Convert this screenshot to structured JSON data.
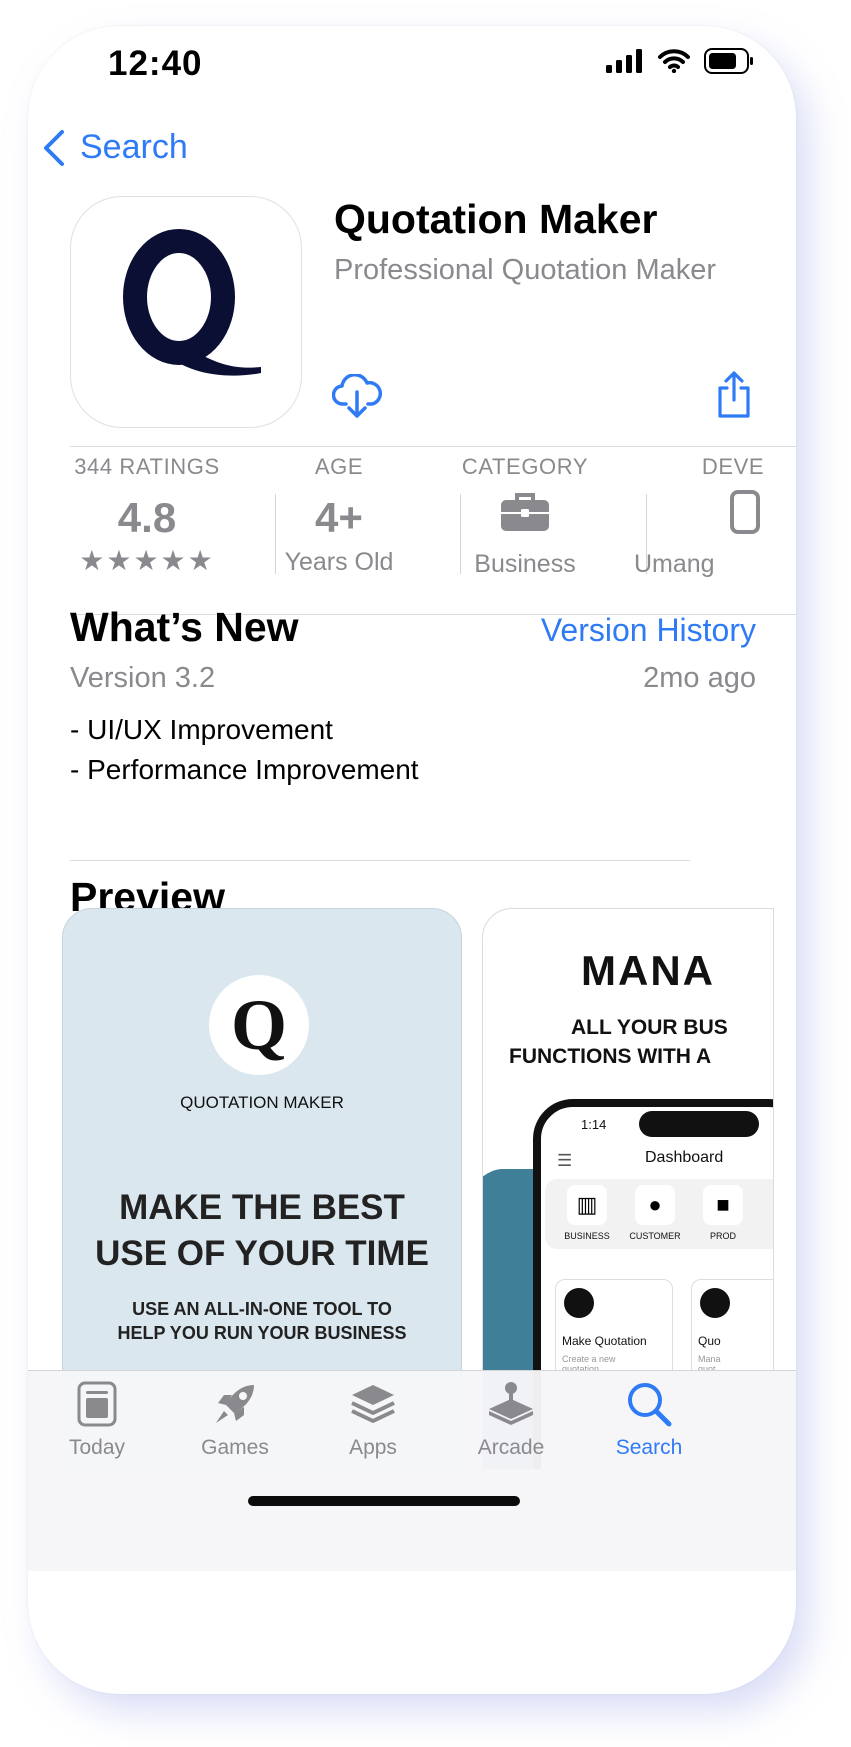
{
  "status_bar": {
    "time": "12:40"
  },
  "nav": {
    "back_label": "Search"
  },
  "app": {
    "name": "Quotation Maker",
    "subtitle": "Professional Quotation Maker",
    "icon_letter": "Q"
  },
  "info": {
    "ratings_label": "344 RATINGS",
    "rating_value": "4.8",
    "stars": "★★★★★",
    "age_label": "AGE",
    "age_value": "4+",
    "age_sub": "Years Old",
    "category_label": "CATEGORY",
    "category_value": "Business",
    "developer_label": "DEVE",
    "developer_value": "Umang"
  },
  "whats_new": {
    "title": "What’s New",
    "version_history": "Version History",
    "version": "Version 3.2",
    "ago": "2mo ago",
    "notes": [
      "- UI/UX Improvement",
      "- Performance Improvement"
    ]
  },
  "preview": {
    "title": "Preview",
    "shot1": {
      "logo_letter": "Q",
      "brand": "QUOTATION MAKER",
      "headline_1": "MAKE THE BEST",
      "headline_2": "USE OF YOUR TIME",
      "sub_1": "USE AN ALL-IN-ONE TOOL TO",
      "sub_2": "HELP YOU RUN YOUR BUSINESS"
    },
    "shot2": {
      "headline": "MANA",
      "sub_1": "ALL YOUR BUS",
      "sub_2": "FUNCTIONS WITH A",
      "phone_time": "1:14",
      "dashboard": "Dashboard",
      "tiles": [
        "BUSINESS",
        "CUSTOMER",
        "PROD"
      ],
      "card1_title": "Make Quotation",
      "card1_sub": "Create a new quotation",
      "card2_title": "Quo",
      "card2_sub": "Mana quot"
    }
  },
  "tabbar": {
    "items": [
      "Today",
      "Games",
      "Apps",
      "Arcade",
      "Search"
    ],
    "active": "Search"
  },
  "colors": {
    "accent": "#2f7bf5",
    "secondary_text": "#8a8a8e",
    "logo_navy": "#0a0f33",
    "preview_bg": "#dbe7ef"
  }
}
